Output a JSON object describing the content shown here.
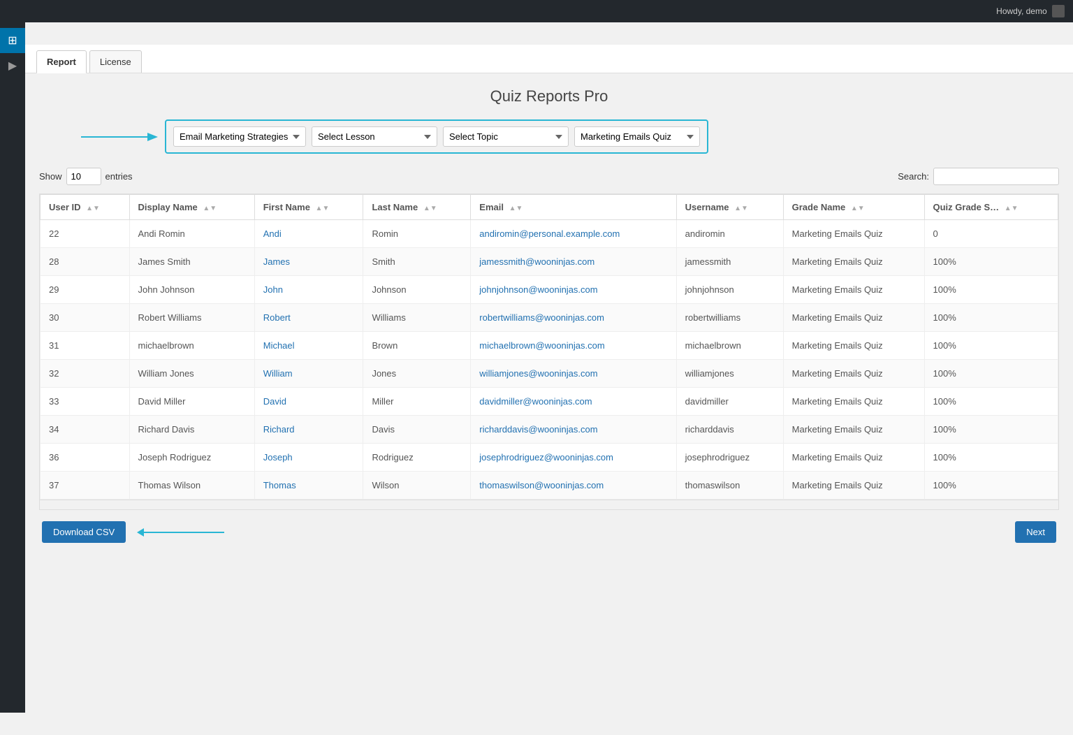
{
  "topbar": {
    "user_label": "Howdy, demo"
  },
  "sidebar": {
    "icons": [
      {
        "name": "dashboard-icon",
        "symbol": "⊞"
      },
      {
        "name": "play-icon",
        "symbol": "▶"
      }
    ]
  },
  "tabs": [
    {
      "label": "Report",
      "active": true
    },
    {
      "label": "License",
      "active": false
    }
  ],
  "page_title": "Quiz Reports Pro",
  "filters": {
    "course_placeholder": "Email Marketing Strategies",
    "lesson_placeholder": "Select Lesson",
    "topic_placeholder": "Select Topic",
    "quiz_placeholder": "Marketing Emails Quiz"
  },
  "table_controls": {
    "show_label": "Show",
    "show_value": "10",
    "entries_label": "entries",
    "search_label": "Search:",
    "search_value": ""
  },
  "table": {
    "columns": [
      {
        "key": "user_id",
        "label": "User ID"
      },
      {
        "key": "display_name",
        "label": "Display Name"
      },
      {
        "key": "first_name",
        "label": "First Name"
      },
      {
        "key": "last_name",
        "label": "Last Name"
      },
      {
        "key": "email",
        "label": "Email"
      },
      {
        "key": "username",
        "label": "Username"
      },
      {
        "key": "grade_name",
        "label": "Grade Name"
      },
      {
        "key": "quiz_grade",
        "label": "Quiz Grade S…"
      }
    ],
    "rows": [
      {
        "user_id": "22",
        "display_name": "Andi Romin",
        "first_name": "Andi",
        "last_name": "Romin",
        "email": "andiromin@personal.example.com",
        "username": "andiromin",
        "grade_name": "Marketing Emails Quiz",
        "quiz_grade": "0"
      },
      {
        "user_id": "28",
        "display_name": "James Smith",
        "first_name": "James",
        "last_name": "Smith",
        "email": "jamessmith@wooninjas.com",
        "username": "jamessmith",
        "grade_name": "Marketing Emails Quiz",
        "quiz_grade": "100%"
      },
      {
        "user_id": "29",
        "display_name": "John Johnson",
        "first_name": "John",
        "last_name": "Johnson",
        "email": "johnjohnson@wooninjas.com",
        "username": "johnjohnson",
        "grade_name": "Marketing Emails Quiz",
        "quiz_grade": "100%"
      },
      {
        "user_id": "30",
        "display_name": "Robert Williams",
        "first_name": "Robert",
        "last_name": "Williams",
        "email": "robertwilliams@wooninjas.com",
        "username": "robertwilliams",
        "grade_name": "Marketing Emails Quiz",
        "quiz_grade": "100%"
      },
      {
        "user_id": "31",
        "display_name": "michaelbrown",
        "first_name": "Michael",
        "last_name": "Brown",
        "email": "michaelbrown@wooninjas.com",
        "username": "michaelbrown",
        "grade_name": "Marketing Emails Quiz",
        "quiz_grade": "100%"
      },
      {
        "user_id": "32",
        "display_name": "William Jones",
        "first_name": "William",
        "last_name": "Jones",
        "email": "williamjones@wooninjas.com",
        "username": "williamjones",
        "grade_name": "Marketing Emails Quiz",
        "quiz_grade": "100%"
      },
      {
        "user_id": "33",
        "display_name": "David Miller",
        "first_name": "David",
        "last_name": "Miller",
        "email": "davidmiller@wooninjas.com",
        "username": "davidmiller",
        "grade_name": "Marketing Emails Quiz",
        "quiz_grade": "100%"
      },
      {
        "user_id": "34",
        "display_name": "Richard Davis",
        "first_name": "Richard",
        "last_name": "Davis",
        "email": "richarddavis@wooninjas.com",
        "username": "richarddavis",
        "grade_name": "Marketing Emails Quiz",
        "quiz_grade": "100%"
      },
      {
        "user_id": "36",
        "display_name": "Joseph Rodriguez",
        "first_name": "Joseph",
        "last_name": "Rodriguez",
        "email": "josephrodriguez@wooninjas.com",
        "username": "josephrodriguez",
        "grade_name": "Marketing Emails Quiz",
        "quiz_grade": "100%"
      },
      {
        "user_id": "37",
        "display_name": "Thomas Wilson",
        "first_name": "Thomas",
        "last_name": "Wilson",
        "email": "thomaswilson@wooninjas.com",
        "username": "thomaswilson",
        "grade_name": "Marketing Emails Quiz",
        "quiz_grade": "100%"
      }
    ]
  },
  "buttons": {
    "download_csv": "Download CSV",
    "next": "Next"
  },
  "colors": {
    "accent_blue": "#29b6d4",
    "link_blue": "#2271b1",
    "btn_blue": "#2271b1"
  }
}
